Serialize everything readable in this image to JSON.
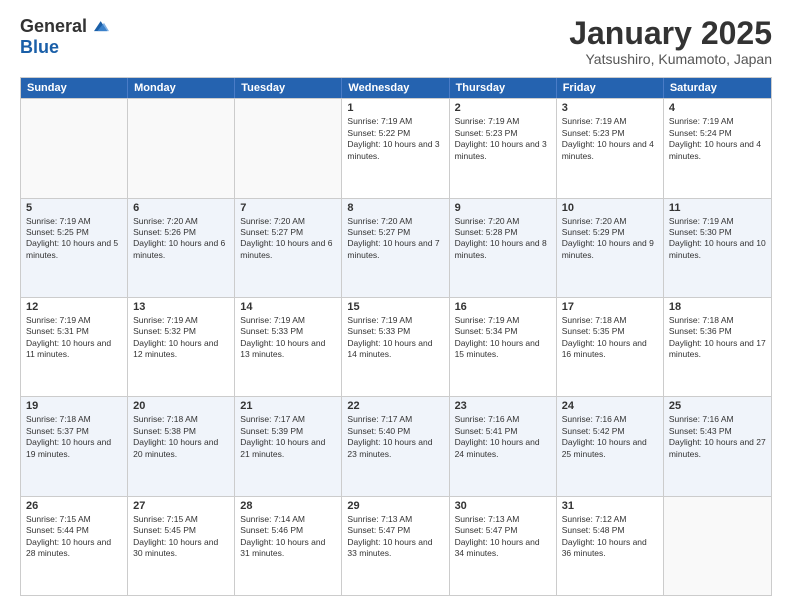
{
  "logo": {
    "general": "General",
    "blue": "Blue"
  },
  "title": "January 2025",
  "location": "Yatsushiro, Kumamoto, Japan",
  "header_days": [
    "Sunday",
    "Monday",
    "Tuesday",
    "Wednesday",
    "Thursday",
    "Friday",
    "Saturday"
  ],
  "rows": [
    [
      {
        "day": "",
        "sunrise": "",
        "sunset": "",
        "daylight": "",
        "empty": true
      },
      {
        "day": "",
        "sunrise": "",
        "sunset": "",
        "daylight": "",
        "empty": true
      },
      {
        "day": "",
        "sunrise": "",
        "sunset": "",
        "daylight": "",
        "empty": true
      },
      {
        "day": "1",
        "sunrise": "Sunrise: 7:19 AM",
        "sunset": "Sunset: 5:22 PM",
        "daylight": "Daylight: 10 hours and 3 minutes."
      },
      {
        "day": "2",
        "sunrise": "Sunrise: 7:19 AM",
        "sunset": "Sunset: 5:23 PM",
        "daylight": "Daylight: 10 hours and 3 minutes."
      },
      {
        "day": "3",
        "sunrise": "Sunrise: 7:19 AM",
        "sunset": "Sunset: 5:23 PM",
        "daylight": "Daylight: 10 hours and 4 minutes."
      },
      {
        "day": "4",
        "sunrise": "Sunrise: 7:19 AM",
        "sunset": "Sunset: 5:24 PM",
        "daylight": "Daylight: 10 hours and 4 minutes."
      }
    ],
    [
      {
        "day": "5",
        "sunrise": "Sunrise: 7:19 AM",
        "sunset": "Sunset: 5:25 PM",
        "daylight": "Daylight: 10 hours and 5 minutes."
      },
      {
        "day": "6",
        "sunrise": "Sunrise: 7:20 AM",
        "sunset": "Sunset: 5:26 PM",
        "daylight": "Daylight: 10 hours and 6 minutes."
      },
      {
        "day": "7",
        "sunrise": "Sunrise: 7:20 AM",
        "sunset": "Sunset: 5:27 PM",
        "daylight": "Daylight: 10 hours and 6 minutes."
      },
      {
        "day": "8",
        "sunrise": "Sunrise: 7:20 AM",
        "sunset": "Sunset: 5:27 PM",
        "daylight": "Daylight: 10 hours and 7 minutes."
      },
      {
        "day": "9",
        "sunrise": "Sunrise: 7:20 AM",
        "sunset": "Sunset: 5:28 PM",
        "daylight": "Daylight: 10 hours and 8 minutes."
      },
      {
        "day": "10",
        "sunrise": "Sunrise: 7:20 AM",
        "sunset": "Sunset: 5:29 PM",
        "daylight": "Daylight: 10 hours and 9 minutes."
      },
      {
        "day": "11",
        "sunrise": "Sunrise: 7:19 AM",
        "sunset": "Sunset: 5:30 PM",
        "daylight": "Daylight: 10 hours and 10 minutes."
      }
    ],
    [
      {
        "day": "12",
        "sunrise": "Sunrise: 7:19 AM",
        "sunset": "Sunset: 5:31 PM",
        "daylight": "Daylight: 10 hours and 11 minutes."
      },
      {
        "day": "13",
        "sunrise": "Sunrise: 7:19 AM",
        "sunset": "Sunset: 5:32 PM",
        "daylight": "Daylight: 10 hours and 12 minutes."
      },
      {
        "day": "14",
        "sunrise": "Sunrise: 7:19 AM",
        "sunset": "Sunset: 5:33 PM",
        "daylight": "Daylight: 10 hours and 13 minutes."
      },
      {
        "day": "15",
        "sunrise": "Sunrise: 7:19 AM",
        "sunset": "Sunset: 5:33 PM",
        "daylight": "Daylight: 10 hours and 14 minutes."
      },
      {
        "day": "16",
        "sunrise": "Sunrise: 7:19 AM",
        "sunset": "Sunset: 5:34 PM",
        "daylight": "Daylight: 10 hours and 15 minutes."
      },
      {
        "day": "17",
        "sunrise": "Sunrise: 7:18 AM",
        "sunset": "Sunset: 5:35 PM",
        "daylight": "Daylight: 10 hours and 16 minutes."
      },
      {
        "day": "18",
        "sunrise": "Sunrise: 7:18 AM",
        "sunset": "Sunset: 5:36 PM",
        "daylight": "Daylight: 10 hours and 17 minutes."
      }
    ],
    [
      {
        "day": "19",
        "sunrise": "Sunrise: 7:18 AM",
        "sunset": "Sunset: 5:37 PM",
        "daylight": "Daylight: 10 hours and 19 minutes."
      },
      {
        "day": "20",
        "sunrise": "Sunrise: 7:18 AM",
        "sunset": "Sunset: 5:38 PM",
        "daylight": "Daylight: 10 hours and 20 minutes."
      },
      {
        "day": "21",
        "sunrise": "Sunrise: 7:17 AM",
        "sunset": "Sunset: 5:39 PM",
        "daylight": "Daylight: 10 hours and 21 minutes."
      },
      {
        "day": "22",
        "sunrise": "Sunrise: 7:17 AM",
        "sunset": "Sunset: 5:40 PM",
        "daylight": "Daylight: 10 hours and 23 minutes."
      },
      {
        "day": "23",
        "sunrise": "Sunrise: 7:16 AM",
        "sunset": "Sunset: 5:41 PM",
        "daylight": "Daylight: 10 hours and 24 minutes."
      },
      {
        "day": "24",
        "sunrise": "Sunrise: 7:16 AM",
        "sunset": "Sunset: 5:42 PM",
        "daylight": "Daylight: 10 hours and 25 minutes."
      },
      {
        "day": "25",
        "sunrise": "Sunrise: 7:16 AM",
        "sunset": "Sunset: 5:43 PM",
        "daylight": "Daylight: 10 hours and 27 minutes."
      }
    ],
    [
      {
        "day": "26",
        "sunrise": "Sunrise: 7:15 AM",
        "sunset": "Sunset: 5:44 PM",
        "daylight": "Daylight: 10 hours and 28 minutes."
      },
      {
        "day": "27",
        "sunrise": "Sunrise: 7:15 AM",
        "sunset": "Sunset: 5:45 PM",
        "daylight": "Daylight: 10 hours and 30 minutes."
      },
      {
        "day": "28",
        "sunrise": "Sunrise: 7:14 AM",
        "sunset": "Sunset: 5:46 PM",
        "daylight": "Daylight: 10 hours and 31 minutes."
      },
      {
        "day": "29",
        "sunrise": "Sunrise: 7:13 AM",
        "sunset": "Sunset: 5:47 PM",
        "daylight": "Daylight: 10 hours and 33 minutes."
      },
      {
        "day": "30",
        "sunrise": "Sunrise: 7:13 AM",
        "sunset": "Sunset: 5:47 PM",
        "daylight": "Daylight: 10 hours and 34 minutes."
      },
      {
        "day": "31",
        "sunrise": "Sunrise: 7:12 AM",
        "sunset": "Sunset: 5:48 PM",
        "daylight": "Daylight: 10 hours and 36 minutes."
      },
      {
        "day": "",
        "sunrise": "",
        "sunset": "",
        "daylight": "",
        "empty": true
      }
    ]
  ]
}
